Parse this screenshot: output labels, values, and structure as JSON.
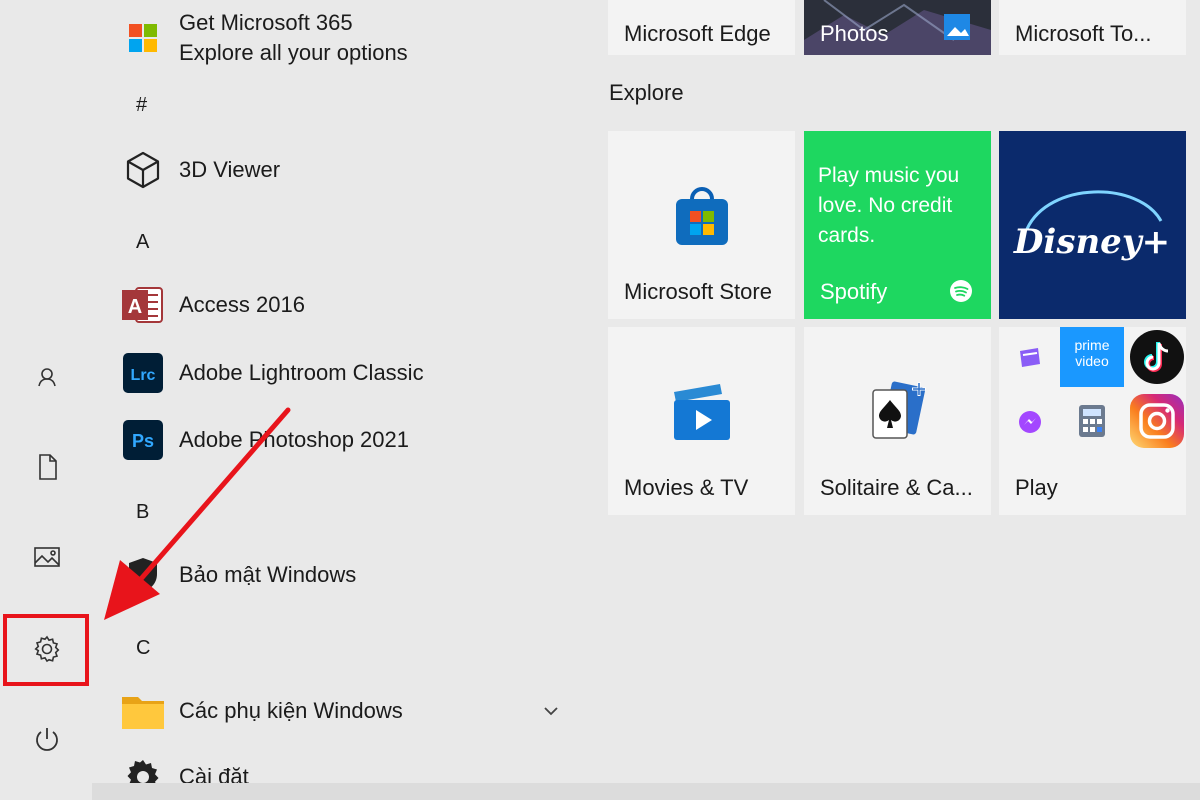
{
  "rail": {
    "items": [
      {
        "name": "user-icon"
      },
      {
        "name": "documents-icon"
      },
      {
        "name": "pictures-icon"
      },
      {
        "name": "settings-icon"
      },
      {
        "name": "power-icon"
      }
    ],
    "highlight_color": "#e8141b"
  },
  "apps": {
    "ms365": {
      "title": "Get Microsoft 365",
      "subtitle": "Explore all your options"
    },
    "headers": {
      "hash": "#",
      "a": "A",
      "b": "B",
      "c": "C"
    },
    "viewer3d": "3D Viewer",
    "access": "Access 2016",
    "lightroom": "Adobe Lightroom Classic",
    "photoshop": "Adobe Photoshop 2021",
    "security": "Bảo mật Windows",
    "accessories": "Các phụ kiện Windows",
    "settings": "Cài đặt"
  },
  "tiles": {
    "edge": "Microsoft Edge",
    "photos": "Photos",
    "todo": "Microsoft To...",
    "group_title": "Explore",
    "store": "Microsoft Store",
    "spotify_promo": "Play music you love. No credit cards.",
    "spotify": "Spotify",
    "disney": "Disney+",
    "movies": "Movies & TV",
    "solitaire": "Solitaire & Ca...",
    "play": "Play",
    "prime_line1": "prime",
    "prime_line2": "video"
  },
  "colors": {
    "spotify": "#1ed760",
    "disney": "#0b2a6c",
    "arrow": "#e8141b"
  }
}
